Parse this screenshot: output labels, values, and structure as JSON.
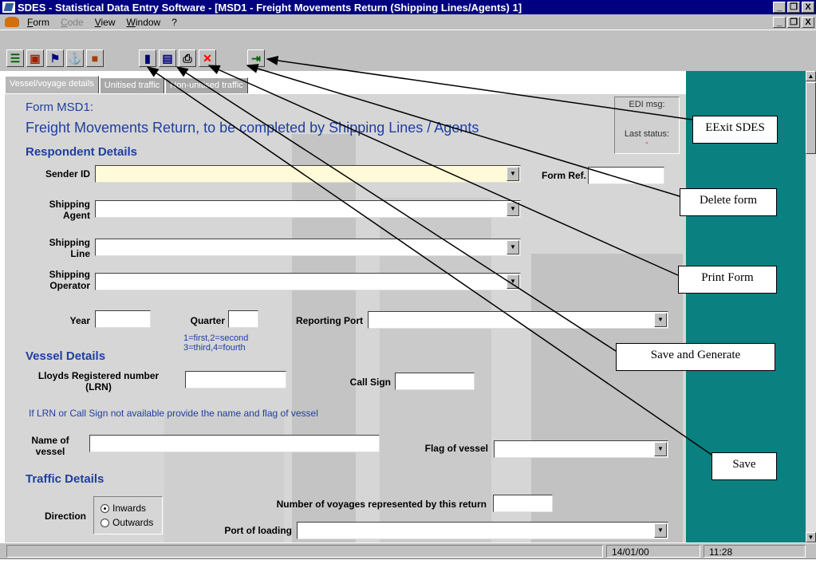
{
  "window": {
    "title": "SDES - Statistical Data Entry Software - [MSD1 - Freight Movements Return (Shipping Lines/Agents) 1]",
    "controls": [
      "_",
      "ə",
      "X"
    ]
  },
  "menu": {
    "items": [
      {
        "label": "Form",
        "enabled": true
      },
      {
        "label": "Code",
        "enabled": false
      },
      {
        "label": "View",
        "enabled": true
      },
      {
        "label": "Window",
        "enabled": true
      },
      {
        "label": "?",
        "enabled": true
      }
    ]
  },
  "toolbar": {
    "buttons": [
      {
        "name": "respondent-icon",
        "glyph": "☰",
        "color": "#006000"
      },
      {
        "name": "cargo-icon",
        "glyph": "▣",
        "color": "#a02000"
      },
      {
        "name": "flag-icon",
        "glyph": "⚑",
        "color": "#000080"
      },
      {
        "name": "port-icon",
        "glyph": "⚓",
        "color": "#0000a0"
      },
      {
        "name": "box-icon",
        "glyph": "■",
        "color": "#a04000"
      },
      {
        "name": "save-icon",
        "glyph": "▮",
        "color": "#000080"
      },
      {
        "name": "save-generate-icon",
        "glyph": "▤",
        "color": "#000080"
      },
      {
        "name": "print-icon",
        "glyph": "⎙",
        "color": "#000000"
      },
      {
        "name": "delete-icon",
        "glyph": "✕",
        "color": "#ff0000"
      },
      {
        "name": "exit-icon",
        "glyph": "⇥",
        "color": "#006000"
      }
    ]
  },
  "tabs": [
    {
      "label": "Vessel/voyage details",
      "active": true
    },
    {
      "label": "Unitised traffic",
      "active": false
    },
    {
      "label": "Non-unitised traffic",
      "active": false
    }
  ],
  "form": {
    "code": "Form MSD1:",
    "title": "Freight Movements Return, to be completed by Shipping Lines / Agents",
    "edi_msg_label": "EDI msg:",
    "edi_msg_value": "-",
    "last_status_label": "Last status:",
    "last_status_value": "-",
    "respondent_header": "Respondent Details",
    "sender_id_label": "Sender ID",
    "form_ref_label": "Form Ref.",
    "shipping_agent_label_1": "Shipping",
    "shipping_agent_label_2": "Agent",
    "shipping_line_label_1": "Shipping",
    "shipping_line_label_2": "Line",
    "shipping_operator_label_1": "Shipping",
    "shipping_operator_label_2": "Operator",
    "year_label": "Year",
    "quarter_label": "Quarter",
    "quarter_hint_1": "1=first,2=second",
    "quarter_hint_2": "3=third,4=fourth",
    "reporting_port_label": "Reporting Port",
    "vessel_header": "Vessel Details",
    "lrn_label_1": "Lloyds Registered number",
    "lrn_label_2": "(LRN)",
    "call_sign_label": "Call Sign",
    "vessel_hint": "If LRN or Call Sign not available provide the name and flag of vessel",
    "name_label_1": "Name of",
    "name_label_2": "vessel",
    "flag_label": "Flag of vessel",
    "traffic_header": "Traffic Details",
    "direction_label": "Direction",
    "direction_options": [
      {
        "label": "Inwards",
        "selected": true
      },
      {
        "label": "Outwards",
        "selected": false
      }
    ],
    "voyages_label": "Number of voyages represented by this return",
    "loading_label": "Port of loading"
  },
  "status": {
    "date": "14/01/00",
    "time": "11:28"
  },
  "callouts": {
    "exit": "EExit SDES",
    "delete": "Delete form",
    "print": "Print Form",
    "save_generate": "Save and Generate",
    "save": "Save"
  }
}
